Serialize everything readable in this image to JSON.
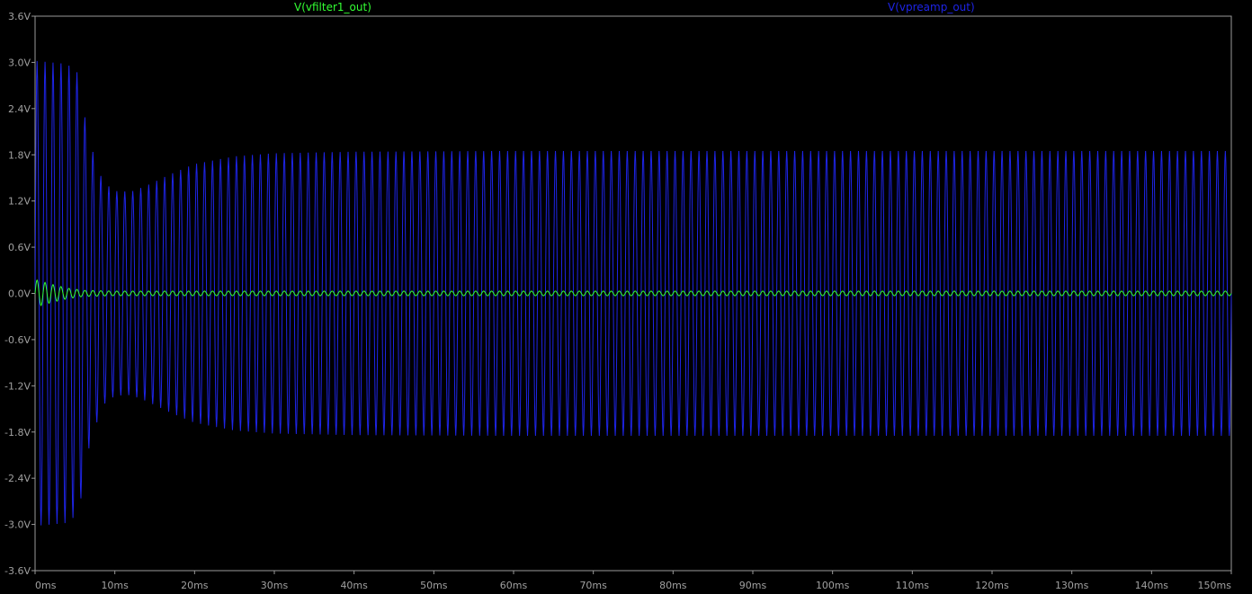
{
  "chart_data": {
    "type": "line",
    "title": "",
    "xlabel": "",
    "ylabel": "",
    "xlim": [
      0,
      150
    ],
    "ylim": [
      -3.6,
      3.6
    ],
    "x_ticks": [
      "0ms",
      "10ms",
      "20ms",
      "30ms",
      "40ms",
      "50ms",
      "60ms",
      "70ms",
      "80ms",
      "90ms",
      "100ms",
      "110ms",
      "120ms",
      "130ms",
      "140ms",
      "150ms"
    ],
    "y_ticks": [
      "3.6V",
      "3.0V",
      "2.4V",
      "1.8V",
      "1.2V",
      "0.6V",
      "0.0V",
      "-0.6V",
      "-1.2V",
      "-1.8V",
      "-2.4V",
      "-3.0V",
      "-3.6V"
    ],
    "grid": false,
    "series": [
      {
        "name": "V(vfilter1_out)",
        "color": "#33ff33",
        "frequency_khz": 1.0,
        "envelope": {
          "x_ms": [
            0,
            2,
            4,
            6,
            10,
            150
          ],
          "amp_v": [
            0.18,
            0.12,
            0.07,
            0.04,
            0.03,
            0.03
          ]
        }
      },
      {
        "name": "V(vpreamp_out)",
        "color": "#1e24e6",
        "frequency_khz": 1.0,
        "envelope": {
          "x_ms": [
            0,
            4,
            5.5,
            6.5,
            7.5,
            8.5,
            10,
            12,
            14,
            17,
            20,
            25,
            30,
            40,
            60,
            100,
            150
          ],
          "amp_v": [
            3.02,
            2.98,
            2.85,
            2.1,
            1.75,
            1.45,
            1.33,
            1.32,
            1.4,
            1.55,
            1.68,
            1.78,
            1.82,
            1.84,
            1.85,
            1.85,
            1.85
          ]
        }
      }
    ]
  }
}
